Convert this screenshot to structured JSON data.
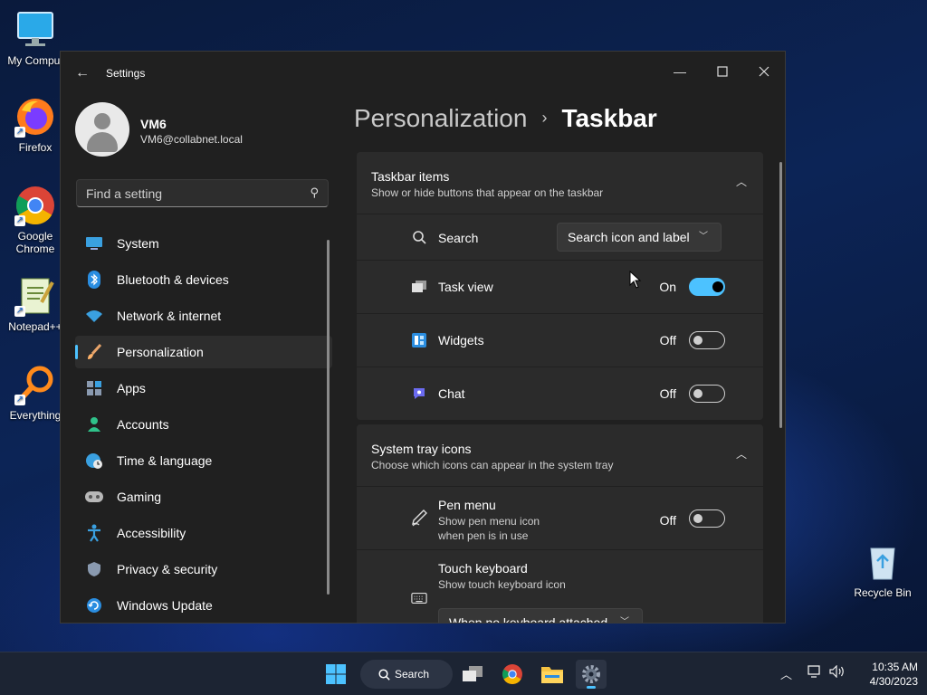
{
  "desktop": {
    "icons": [
      {
        "label": "My Comput"
      },
      {
        "label": "Firefox"
      },
      {
        "label": "Google Chrome"
      },
      {
        "label": "Notepad++"
      },
      {
        "label": "Everything"
      },
      {
        "label": "Recycle Bin"
      }
    ]
  },
  "window": {
    "title": "Settings",
    "profile": {
      "name": "VM6",
      "email": "VM6@collabnet.local"
    },
    "search_placeholder": "Find a setting",
    "nav": [
      {
        "label": "System",
        "icon": "monitor-icon"
      },
      {
        "label": "Bluetooth & devices",
        "icon": "bluetooth-icon"
      },
      {
        "label": "Network & internet",
        "icon": "wifi-icon"
      },
      {
        "label": "Personalization",
        "icon": "brush-icon",
        "active": true
      },
      {
        "label": "Apps",
        "icon": "apps-icon"
      },
      {
        "label": "Accounts",
        "icon": "person-icon"
      },
      {
        "label": "Time & language",
        "icon": "clock-globe-icon"
      },
      {
        "label": "Gaming",
        "icon": "gamepad-icon"
      },
      {
        "label": "Accessibility",
        "icon": "accessibility-icon"
      },
      {
        "label": "Privacy & security",
        "icon": "shield-icon"
      },
      {
        "label": "Windows Update",
        "icon": "refresh-icon"
      }
    ],
    "breadcrumb": {
      "parent": "Personalization",
      "separator": "›",
      "current": "Taskbar"
    },
    "sections": {
      "taskbar_items": {
        "title": "Taskbar items",
        "description": "Show or hide buttons that appear on the taskbar",
        "search": {
          "label": "Search",
          "value": "Search icon and label"
        },
        "task_view": {
          "label": "Task view",
          "state": "On",
          "on": true
        },
        "widgets": {
          "label": "Widgets",
          "state": "Off",
          "on": false
        },
        "chat": {
          "label": "Chat",
          "state": "Off",
          "on": false
        }
      },
      "system_tray": {
        "title": "System tray icons",
        "description": "Choose which icons can appear in the system tray",
        "pen_menu": {
          "label": "Pen menu",
          "sub1": "Show pen menu icon",
          "sub2": "when pen is in use",
          "state": "Off",
          "on": false
        },
        "touch_keyboard": {
          "label": "Touch keyboard",
          "sub": "Show touch keyboard icon",
          "value": "When no keyboard attached"
        }
      }
    }
  },
  "taskbar": {
    "search_label": "Search",
    "time": "10:35 AM",
    "date": "4/30/2023"
  },
  "colors": {
    "accent": "#4cc2ff",
    "window_bg": "#202020",
    "card_bg": "#2b2b2b"
  }
}
